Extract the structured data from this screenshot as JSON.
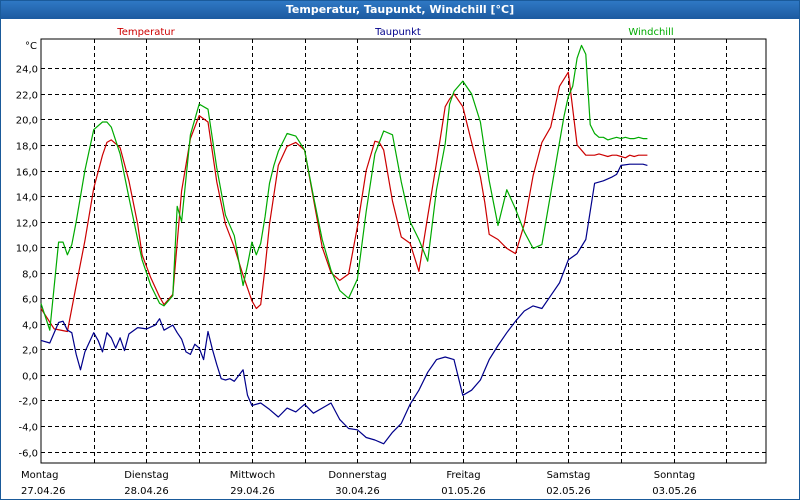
{
  "window": {
    "title": "Temperatur, Taupunkt, Windchill [°C]"
  },
  "chart_data": {
    "type": "line",
    "title": "Temperatur, Taupunkt, Windchill [°C]",
    "ylabel": "°C",
    "ylim": [
      -6.9,
      26.3
    ],
    "xlim": [
      0,
      165
    ],
    "yticks": [
      -6.0,
      -4.0,
      -2.0,
      0.0,
      2.0,
      4.0,
      6.0,
      8.0,
      10.0,
      12.0,
      14.0,
      16.0,
      18.0,
      20.0,
      22.0,
      24.0
    ],
    "ytick_labels": [
      "-6,0",
      "-4,0",
      "-2,0",
      "0,0",
      "2,0",
      "4,0",
      "6,0",
      "8,0",
      "10,0",
      "12,0",
      "14,0",
      "16,0",
      "18,0",
      "20,0",
      "22,0",
      "24,0"
    ],
    "x_minor_gridlines": [
      12,
      36,
      60,
      84,
      108,
      132,
      156
    ],
    "days": [
      {
        "name": "Montag",
        "date": "27.04.26",
        "hour": 0
      },
      {
        "name": "Dienstag",
        "date": "28.04.26",
        "hour": 24
      },
      {
        "name": "Mittwoch",
        "date": "29.04.26",
        "hour": 48
      },
      {
        "name": "Donnerstag",
        "date": "30.04.26",
        "hour": 72
      },
      {
        "name": "Freitag",
        "date": "01.05.26",
        "hour": 96
      },
      {
        "name": "Samstag",
        "date": "02.05.26",
        "hour": 120
      },
      {
        "name": "Sonntag",
        "date": "03.05.26",
        "hour": 144
      }
    ],
    "grid": true,
    "series": [
      {
        "name": "Temperatur",
        "color": "#cc0000",
        "x": [
          0,
          3,
          6,
          8,
          10,
          12,
          14,
          15,
          16,
          18,
          20,
          22,
          23,
          25,
          27,
          28,
          30,
          32,
          34,
          36,
          38,
          40,
          42,
          44,
          46,
          48,
          49,
          50,
          51,
          52,
          54,
          56,
          58,
          60,
          62,
          64,
          66,
          68,
          70,
          72,
          74,
          76,
          77,
          78,
          80,
          82,
          84,
          86,
          88,
          90,
          92,
          93,
          94,
          96,
          98,
          100,
          101,
          102,
          104,
          106,
          108,
          110,
          112,
          114,
          116,
          118,
          120,
          122,
          124,
          126,
          127,
          128,
          129,
          130,
          131,
          132,
          133,
          134,
          135,
          136,
          137,
          138
        ],
        "y": [
          5.2,
          3.6,
          3.4,
          7.0,
          10.5,
          14.6,
          17.2,
          18.2,
          18.4,
          17.8,
          15.2,
          11.8,
          9.4,
          7.6,
          6.1,
          5.5,
          6.3,
          14.4,
          18.5,
          20.3,
          19.8,
          15.1,
          11.8,
          10.0,
          7.8,
          5.8,
          5.2,
          5.5,
          8.4,
          11.8,
          16.4,
          17.9,
          18.2,
          17.6,
          13.8,
          10.0,
          8.0,
          7.4,
          7.9,
          11.6,
          16.0,
          18.3,
          18.2,
          17.6,
          13.6,
          10.8,
          10.3,
          8.1,
          12.4,
          16.6,
          21.0,
          21.6,
          22.0,
          21.0,
          18.2,
          15.5,
          13.5,
          11.0,
          10.6,
          9.9,
          9.5,
          11.8,
          15.6,
          18.2,
          19.4,
          22.6,
          23.7,
          18.0,
          17.2,
          17.2,
          17.3,
          17.2,
          17.1,
          17.2,
          17.2,
          17.1,
          17.0,
          17.2,
          17.1,
          17.2,
          17.2,
          17.2
        ]
      },
      {
        "name": "Taupunkt",
        "color": "#00008b",
        "x": [
          0,
          2,
          4,
          5,
          6,
          7,
          8,
          9,
          10,
          12,
          13,
          14,
          15,
          16,
          17,
          18,
          19,
          20,
          22,
          24,
          26,
          27,
          28,
          30,
          31,
          32,
          33,
          34,
          35,
          36,
          37,
          38,
          39,
          40,
          41,
          42,
          43,
          44,
          46,
          47,
          48,
          50,
          52,
          54,
          56,
          58,
          60,
          62,
          64,
          66,
          68,
          70,
          72,
          74,
          76,
          78,
          80,
          82,
          84,
          86,
          88,
          90,
          92,
          94,
          96,
          98,
          100,
          102,
          104,
          106,
          108,
          110,
          112,
          114,
          116,
          118,
          120,
          122,
          124,
          126,
          128,
          130,
          131,
          132,
          134,
          136,
          137,
          138
        ],
        "y": [
          2.7,
          2.5,
          4.1,
          4.2,
          3.5,
          3.3,
          1.6,
          0.4,
          1.8,
          3.3,
          2.7,
          1.8,
          3.3,
          2.9,
          2.1,
          2.9,
          1.9,
          3.2,
          3.7,
          3.6,
          3.9,
          4.4,
          3.5,
          3.9,
          3.3,
          2.8,
          1.8,
          1.6,
          2.4,
          2.1,
          1.2,
          3.4,
          2.0,
          0.8,
          -0.3,
          -0.4,
          -0.3,
          -0.5,
          0.4,
          -1.6,
          -2.4,
          -2.2,
          -2.7,
          -3.3,
          -2.6,
          -2.9,
          -2.3,
          -3.0,
          -2.6,
          -2.2,
          -3.5,
          -4.2,
          -4.3,
          -4.9,
          -5.1,
          -5.4,
          -4.5,
          -3.8,
          -2.3,
          -1.2,
          0.2,
          1.2,
          1.4,
          1.2,
          -1.6,
          -1.2,
          -0.4,
          1.2,
          2.3,
          3.3,
          4.2,
          5.0,
          5.4,
          5.2,
          6.2,
          7.2,
          9.0,
          9.5,
          10.6,
          15.0,
          15.2,
          15.5,
          15.7,
          16.4,
          16.5,
          16.5,
          16.5,
          16.4
        ]
      },
      {
        "name": "Windchill",
        "color": "#00aa00",
        "x": [
          0,
          2,
          4,
          5,
          6,
          7,
          8,
          10,
          12,
          14,
          15,
          16,
          18,
          20,
          22,
          23,
          25,
          27,
          28,
          30,
          31,
          32,
          34,
          36,
          38,
          40,
          42,
          44,
          46,
          47,
          48,
          49,
          50,
          51,
          52,
          53,
          54,
          56,
          58,
          60,
          62,
          64,
          66,
          68,
          70,
          72,
          74,
          76,
          78,
          80,
          82,
          84,
          86,
          88,
          90,
          92,
          93,
          94,
          96,
          98,
          100,
          102,
          104,
          106,
          108,
          110,
          112,
          114,
          116,
          118,
          119,
          120,
          121,
          122,
          123,
          124,
          125,
          126,
          127,
          128,
          129,
          130,
          131,
          132,
          133,
          134,
          135,
          136,
          137,
          138
        ],
        "y": [
          5.6,
          3.5,
          10.4,
          10.4,
          9.4,
          10.2,
          12.0,
          16.0,
          19.2,
          19.8,
          19.8,
          19.4,
          17.3,
          13.9,
          10.6,
          9.0,
          7.0,
          5.6,
          5.4,
          6.2,
          13.2,
          12.0,
          18.8,
          21.2,
          20.8,
          16.2,
          12.5,
          10.9,
          7.0,
          8.6,
          10.4,
          9.4,
          10.3,
          12.4,
          15.0,
          16.4,
          17.5,
          18.9,
          18.7,
          17.6,
          14.0,
          10.6,
          8.2,
          6.6,
          6.0,
          7.5,
          12.8,
          17.3,
          19.1,
          18.8,
          15.1,
          12.0,
          10.6,
          8.9,
          14.5,
          18.1,
          21.2,
          22.2,
          23.0,
          22.0,
          19.8,
          15.2,
          11.7,
          14.5,
          13.0,
          11.2,
          9.9,
          10.2,
          14.2,
          18.2,
          20.2,
          21.8,
          22.6,
          24.8,
          25.8,
          25.1,
          19.6,
          18.9,
          18.6,
          18.6,
          18.4,
          18.5,
          18.6,
          18.5,
          18.6,
          18.5,
          18.5,
          18.6,
          18.5,
          18.5
        ]
      }
    ]
  }
}
